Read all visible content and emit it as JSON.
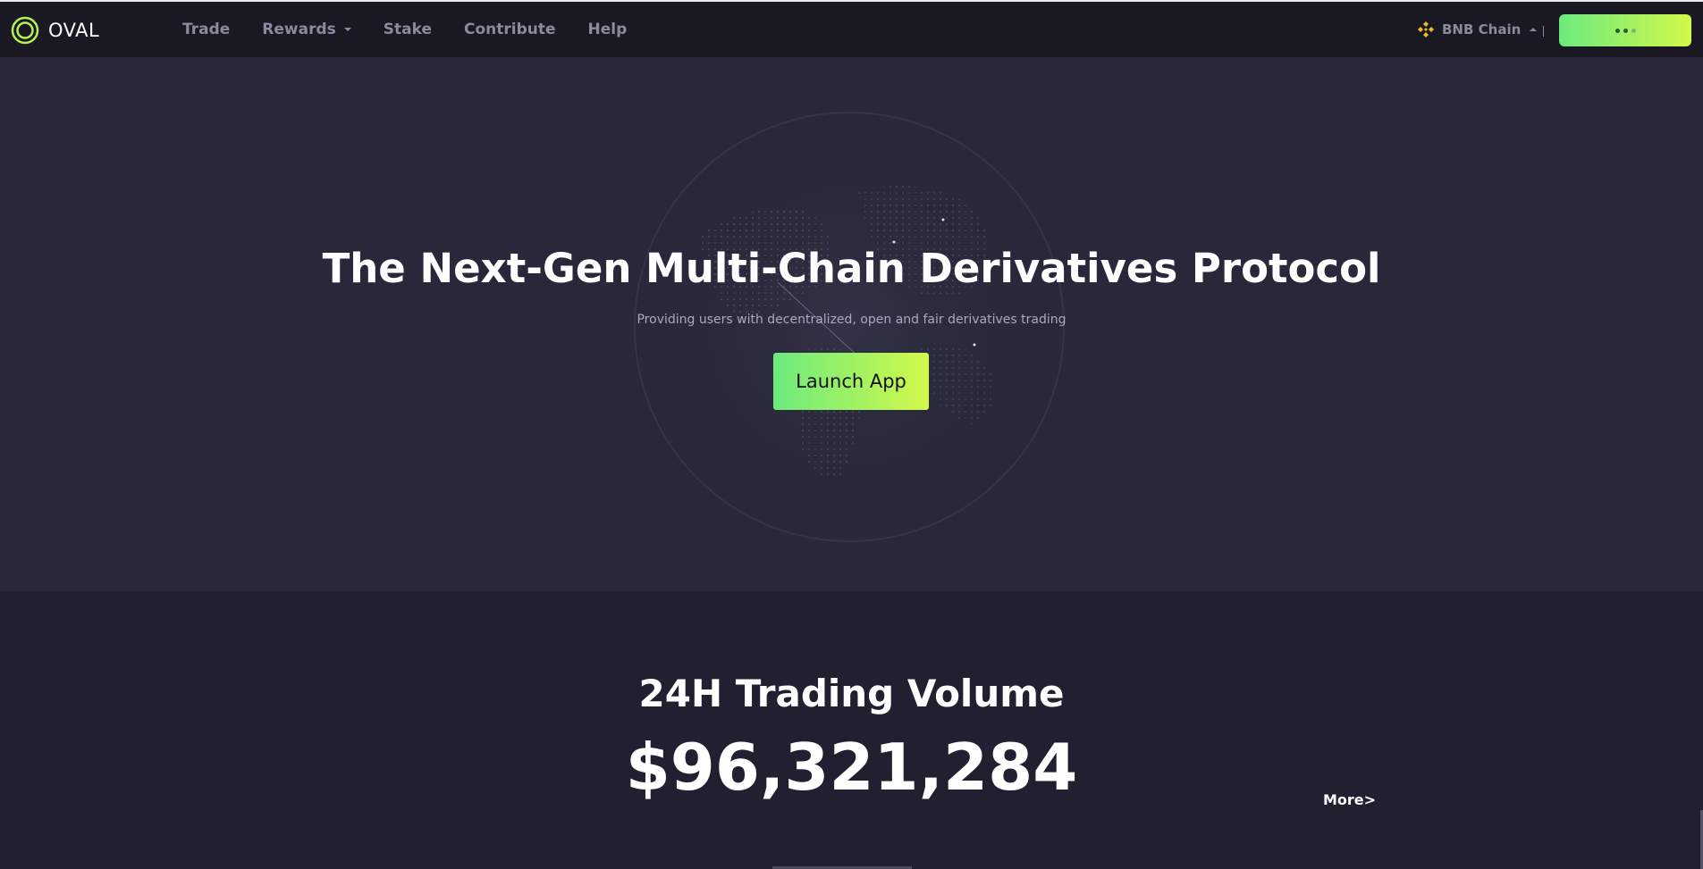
{
  "brand": {
    "name": "OVAL",
    "accent": "#b6f24f",
    "accent_gradient": [
      "#6cea7e",
      "#d2f84a"
    ]
  },
  "nav": {
    "items": [
      {
        "label": "Trade",
        "has_dropdown": false
      },
      {
        "label": "Rewards",
        "has_dropdown": true
      },
      {
        "label": "Stake",
        "has_dropdown": false
      },
      {
        "label": "Contribute",
        "has_dropdown": false
      },
      {
        "label": "Help",
        "has_dropdown": false
      }
    ],
    "chain": {
      "label": "BNB Chain",
      "icon": "bnb-chain-icon",
      "icon_color": "#f3ba2f"
    },
    "wallet_button": {
      "state": "loading",
      "icon": "loading-dots-icon"
    }
  },
  "hero": {
    "title": "The Next-Gen Multi-Chain Derivatives Protocol",
    "subtitle": "Providing users with decentralized, open and fair derivatives trading",
    "cta_label": "Launch App",
    "background_icon": "globe-icon"
  },
  "stats": {
    "title": "24H Trading Volume",
    "value": "$96,321,284",
    "more_label": "More>"
  }
}
